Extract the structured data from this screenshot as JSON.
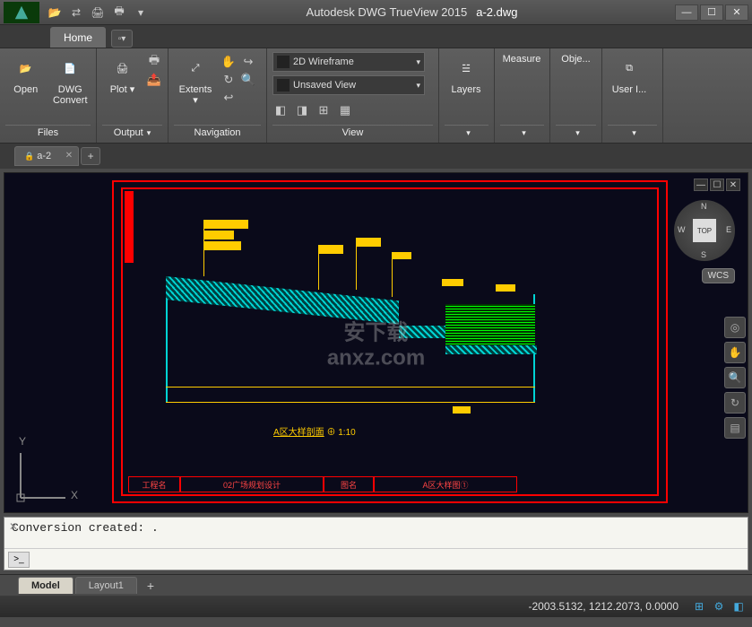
{
  "title": {
    "app": "Autodesk DWG TrueView 2015",
    "file": "a-2.dwg"
  },
  "ribbon": {
    "tabs": [
      "Home"
    ],
    "panels": {
      "files": {
        "title": "Files",
        "open": "Open",
        "dwgconvert": "DWG Convert"
      },
      "output": {
        "title": "Output",
        "plot": "Plot"
      },
      "navigation": {
        "title": "Navigation",
        "extents": "Extents"
      },
      "view": {
        "title": "View",
        "visualstyle": "2D Wireframe",
        "namedview": "Unsaved View"
      },
      "layers": {
        "title": "Layers",
        "label": "Layers"
      },
      "measure": {
        "title": "Measure",
        "label": "Measure"
      },
      "obj": {
        "title": "Obje...",
        "label": "Obje..."
      },
      "user": {
        "title": "User I...",
        "label": "User I..."
      }
    }
  },
  "dwg_tabs": {
    "active": "a-2",
    "items": [
      "a-2"
    ]
  },
  "canvas": {
    "scale_label": "1:10",
    "ucs": {
      "x": "X",
      "y": "Y"
    },
    "viewcube": {
      "top": "TOP",
      "n": "N",
      "s": "S",
      "e": "E",
      "w": "W"
    },
    "wcs": "WCS",
    "titleblock": {
      "c1": "工程名",
      "c2": "02广场规划设计",
      "c3": "图名",
      "c4": "A区大样图①"
    },
    "watermark": "安下载\nanxz.com"
  },
  "commandline": {
    "output": "Conversion created: .",
    "prompt": ">_",
    "input": ""
  },
  "layout_tabs": {
    "active": "Model",
    "items": [
      "Model",
      "Layout1"
    ]
  },
  "statusbar": {
    "coords": "-2003.5132, 1212.2073, 0.0000"
  }
}
